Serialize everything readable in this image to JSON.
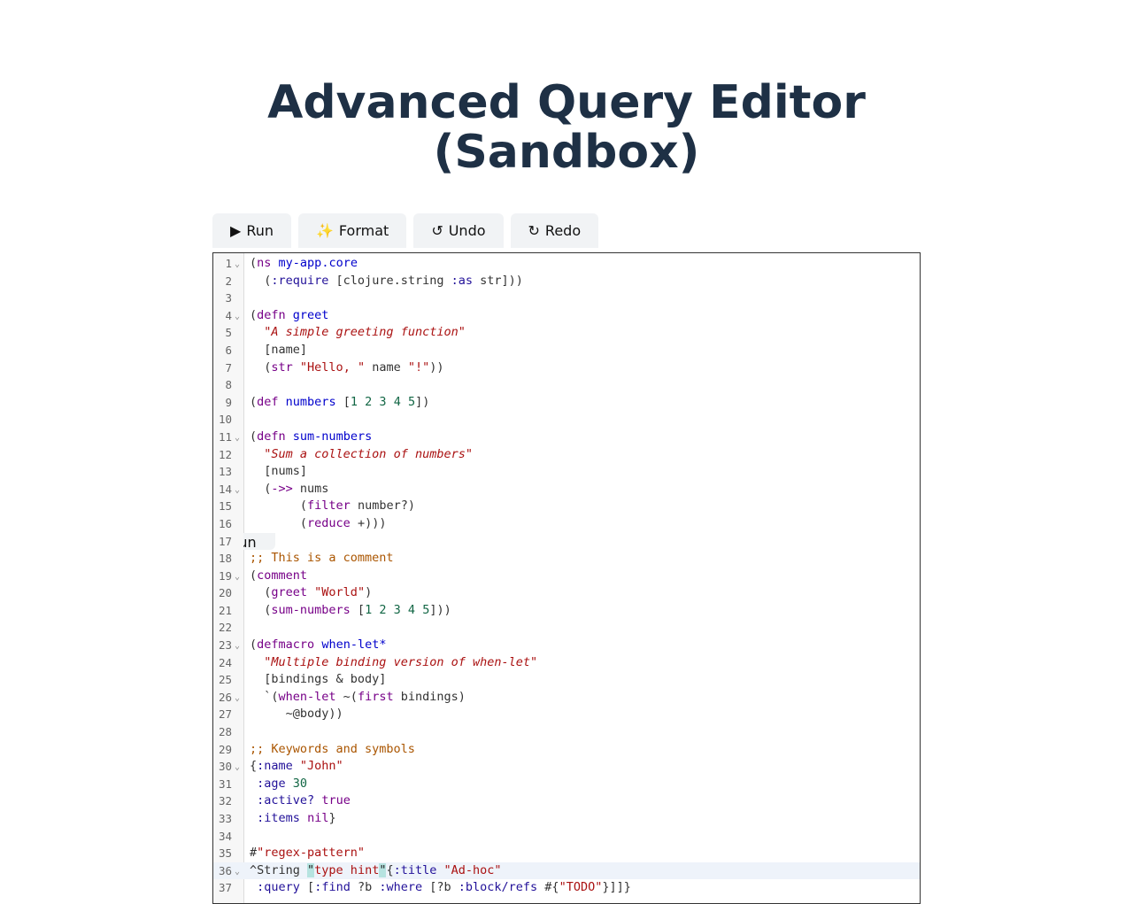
{
  "page": {
    "title_line1": "Advanced Query Editor",
    "title_line2": "(Sandbox)"
  },
  "toolbar": {
    "buttons": [
      {
        "icon": "▶",
        "icon_name": "play-icon",
        "label": "Run"
      },
      {
        "icon": "✨",
        "icon_name": "sparkles-icon",
        "label": "Format"
      },
      {
        "icon": "↺",
        "icon_name": "undo-icon",
        "label": "Undo"
      },
      {
        "icon": "↻",
        "icon_name": "redo-icon",
        "label": "Redo"
      }
    ]
  },
  "overlay_ghost": {
    "label": "Run"
  },
  "editor": {
    "language": "clojure",
    "active_line": 36,
    "lines": [
      {
        "n": "1",
        "fold": true,
        "segs": [
          [
            "p",
            "("
          ],
          [
            "k",
            "ns"
          ],
          [
            "p",
            " "
          ],
          [
            "d",
            "my-app.core"
          ]
        ]
      },
      {
        "n": "2",
        "segs": [
          [
            "p",
            "  ("
          ],
          [
            "kw",
            ":require"
          ],
          [
            "p",
            " [clojure.string "
          ],
          [
            "kw",
            ":as"
          ],
          [
            "p",
            " str]))"
          ]
        ]
      },
      {
        "n": "3",
        "segs": []
      },
      {
        "n": "4",
        "fold": true,
        "segs": [
          [
            "p",
            "("
          ],
          [
            "k",
            "defn"
          ],
          [
            "p",
            " "
          ],
          [
            "d",
            "greet"
          ]
        ]
      },
      {
        "n": "5",
        "segs": [
          [
            "p",
            "  "
          ],
          [
            "doc",
            "\"A simple greeting function\""
          ]
        ]
      },
      {
        "n": "6",
        "segs": [
          [
            "p",
            "  [name]"
          ]
        ]
      },
      {
        "n": "7",
        "segs": [
          [
            "p",
            "  ("
          ],
          [
            "k",
            "str"
          ],
          [
            "p",
            " "
          ],
          [
            "s",
            "\"Hello, \""
          ],
          [
            "p",
            " name "
          ],
          [
            "s",
            "\"!\""
          ],
          [
            "p",
            "))"
          ]
        ]
      },
      {
        "n": "8",
        "segs": []
      },
      {
        "n": "9",
        "segs": [
          [
            "p",
            "("
          ],
          [
            "k",
            "def"
          ],
          [
            "p",
            " "
          ],
          [
            "d",
            "numbers"
          ],
          [
            "p",
            " ["
          ],
          [
            "n",
            "1"
          ],
          [
            "p",
            " "
          ],
          [
            "n",
            "2"
          ],
          [
            "p",
            " "
          ],
          [
            "n",
            "3"
          ],
          [
            "p",
            " "
          ],
          [
            "n",
            "4"
          ],
          [
            "p",
            " "
          ],
          [
            "n",
            "5"
          ],
          [
            "p",
            "])"
          ]
        ]
      },
      {
        "n": "10",
        "segs": []
      },
      {
        "n": "11",
        "fold": true,
        "segs": [
          [
            "p",
            "("
          ],
          [
            "k",
            "defn"
          ],
          [
            "p",
            " "
          ],
          [
            "d",
            "sum-numbers"
          ]
        ]
      },
      {
        "n": "12",
        "segs": [
          [
            "p",
            "  "
          ],
          [
            "doc",
            "\"Sum a collection of numbers\""
          ]
        ]
      },
      {
        "n": "13",
        "segs": [
          [
            "p",
            "  [nums]"
          ]
        ]
      },
      {
        "n": "14",
        "fold": true,
        "segs": [
          [
            "p",
            "  ("
          ],
          [
            "k",
            "->>"
          ],
          [
            "p",
            " nums"
          ]
        ]
      },
      {
        "n": "15",
        "segs": [
          [
            "p",
            "       ("
          ],
          [
            "k",
            "filter"
          ],
          [
            "p",
            " number?)"
          ]
        ]
      },
      {
        "n": "16",
        "segs": [
          [
            "p",
            "       ("
          ],
          [
            "k",
            "reduce"
          ],
          [
            "p",
            " +)))"
          ]
        ]
      },
      {
        "n": "17",
        "ghost": true,
        "segs": []
      },
      {
        "n": "18",
        "segs": [
          [
            "c",
            ";; This is a comment"
          ]
        ]
      },
      {
        "n": "19",
        "fold": true,
        "segs": [
          [
            "p",
            "("
          ],
          [
            "k",
            "comment"
          ]
        ]
      },
      {
        "n": "20",
        "segs": [
          [
            "p",
            "  ("
          ],
          [
            "k",
            "greet"
          ],
          [
            "p",
            " "
          ],
          [
            "s",
            "\"World\""
          ],
          [
            "p",
            ")"
          ]
        ]
      },
      {
        "n": "21",
        "segs": [
          [
            "p",
            "  ("
          ],
          [
            "k",
            "sum-numbers"
          ],
          [
            "p",
            " ["
          ],
          [
            "n",
            "1"
          ],
          [
            "p",
            " "
          ],
          [
            "n",
            "2"
          ],
          [
            "p",
            " "
          ],
          [
            "n",
            "3"
          ],
          [
            "p",
            " "
          ],
          [
            "n",
            "4"
          ],
          [
            "p",
            " "
          ],
          [
            "n",
            "5"
          ],
          [
            "p",
            "]))"
          ]
        ]
      },
      {
        "n": "22",
        "segs": []
      },
      {
        "n": "23",
        "fold": true,
        "segs": [
          [
            "p",
            "("
          ],
          [
            "k",
            "defmacro"
          ],
          [
            "p",
            " "
          ],
          [
            "d",
            "when-let*"
          ]
        ]
      },
      {
        "n": "24",
        "segs": [
          [
            "p",
            "  "
          ],
          [
            "doc",
            "\"Multiple binding version of when-let\""
          ]
        ]
      },
      {
        "n": "25",
        "segs": [
          [
            "p",
            "  [bindings & body]"
          ]
        ]
      },
      {
        "n": "26",
        "fold": true,
        "segs": [
          [
            "p",
            "  `("
          ],
          [
            "k",
            "when-let"
          ],
          [
            "p",
            " ~("
          ],
          [
            "k",
            "first"
          ],
          [
            "p",
            " bindings)"
          ]
        ]
      },
      {
        "n": "27",
        "segs": [
          [
            "p",
            "     ~@body))"
          ]
        ]
      },
      {
        "n": "28",
        "segs": []
      },
      {
        "n": "29",
        "segs": [
          [
            "c",
            ";; Keywords and symbols"
          ]
        ]
      },
      {
        "n": "30",
        "fold": true,
        "segs": [
          [
            "p",
            "{"
          ],
          [
            "a",
            ":name"
          ],
          [
            "p",
            " "
          ],
          [
            "s",
            "\"John\""
          ]
        ]
      },
      {
        "n": "31",
        "segs": [
          [
            "p",
            " "
          ],
          [
            "a",
            ":age"
          ],
          [
            "p",
            " "
          ],
          [
            "n",
            "30"
          ]
        ]
      },
      {
        "n": "32",
        "segs": [
          [
            "p",
            " "
          ],
          [
            "a",
            ":active?"
          ],
          [
            "p",
            " "
          ],
          [
            "k",
            "true"
          ]
        ]
      },
      {
        "n": "33",
        "segs": [
          [
            "p",
            " "
          ],
          [
            "a",
            ":items"
          ],
          [
            "p",
            " "
          ],
          [
            "k",
            "nil"
          ],
          [
            "p",
            "}"
          ]
        ]
      },
      {
        "n": "34",
        "segs": []
      },
      {
        "n": "35",
        "segs": [
          [
            "p",
            "#"
          ],
          [
            "s",
            "\"regex-pattern\""
          ]
        ]
      },
      {
        "n": "36",
        "fold": true,
        "segs": [
          [
            "p",
            "^String "
          ],
          [
            "hl",
            "\""
          ],
          [
            "s",
            "type hint"
          ],
          [
            "hl",
            "\""
          ],
          [
            "p",
            "{"
          ],
          [
            "a",
            ":title"
          ],
          [
            "p",
            " "
          ],
          [
            "s",
            "\"Ad-hoc\""
          ]
        ]
      },
      {
        "n": "37",
        "segs": [
          [
            "p",
            " "
          ],
          [
            "a",
            ":query"
          ],
          [
            "p",
            " ["
          ],
          [
            "a",
            ":find"
          ],
          [
            "p",
            " ?b "
          ],
          [
            "a",
            ":where"
          ],
          [
            "p",
            " [?b "
          ],
          [
            "a",
            ":block/refs"
          ],
          [
            "p",
            " #{"
          ],
          [
            "s",
            "\"TODO\""
          ],
          [
            "p",
            "}]]}"
          ]
        ]
      }
    ]
  }
}
